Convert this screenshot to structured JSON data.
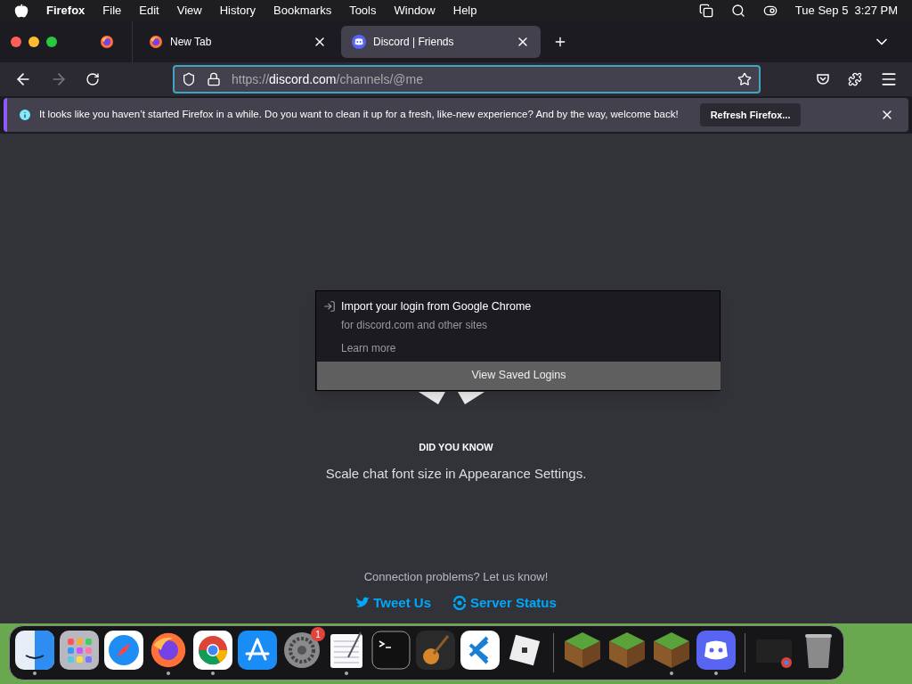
{
  "menu_bar": {
    "app": "Firefox",
    "items": [
      "File",
      "Edit",
      "View",
      "History",
      "Bookmarks",
      "Tools",
      "Window",
      "Help"
    ],
    "clock": "Tue Sep 5  3:27 PM"
  },
  "tabs": [
    {
      "title": "New Tab",
      "kind": "firefox",
      "selected": false
    },
    {
      "title": "Discord | Friends",
      "kind": "discord",
      "selected": true
    }
  ],
  "url": {
    "scheme": "https://",
    "domain": "discord.com",
    "path": "/channels/@me"
  },
  "notification": {
    "message": "It looks like you haven’t started Firefox in a while. Do you want to clean it up for a fresh, like-new experience? And by the way, welcome back!",
    "button": "Refresh Firefox..."
  },
  "login_popup": {
    "title": "Import your login from Google Chrome",
    "subtitle": "for discord.com and other sites",
    "link": "Learn more",
    "button": "View Saved Logins"
  },
  "tip": {
    "heading": "DID YOU KNOW",
    "text": "Scale chat font size in Appearance Settings."
  },
  "connection": {
    "text": "Connection problems? Let us know!",
    "links": [
      {
        "label": "Tweet Us",
        "kind": "twitter"
      },
      {
        "label": "Server Status",
        "kind": "status"
      }
    ]
  },
  "dock": [
    {
      "kind": "finder",
      "running": true
    },
    {
      "kind": "launchpad",
      "running": false
    },
    {
      "kind": "safari",
      "running": false
    },
    {
      "kind": "firefox",
      "running": true
    },
    {
      "kind": "chrome",
      "running": true
    },
    {
      "kind": "appstore",
      "running": false
    },
    {
      "kind": "settings",
      "running": false,
      "badge": "1"
    },
    {
      "kind": "textedit",
      "running": true
    },
    {
      "kind": "terminal",
      "running": false
    },
    {
      "kind": "guitar",
      "running": false
    },
    {
      "kind": "vscode",
      "running": false
    },
    {
      "kind": "roblox",
      "running": false
    },
    {
      "kind": "divider"
    },
    {
      "kind": "grass",
      "running": false
    },
    {
      "kind": "grass",
      "running": false
    },
    {
      "kind": "grass",
      "running": true
    },
    {
      "kind": "discord",
      "running": true
    },
    {
      "kind": "divider"
    },
    {
      "kind": "window",
      "running": false
    },
    {
      "kind": "trash",
      "running": false
    }
  ]
}
